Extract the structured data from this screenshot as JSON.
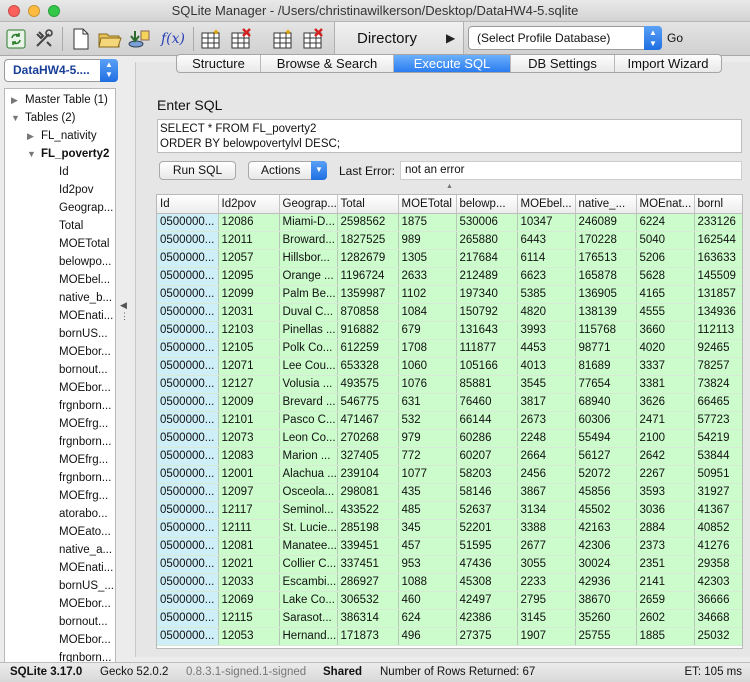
{
  "window": {
    "title": "SQLite Manager - /Users/christinawilkerson/Desktop/DataHW4-5.sqlite"
  },
  "toolbar": {
    "directory_label": "Directory",
    "profile_select": "(Select Profile Database)",
    "go_label": "Go",
    "fx_label": "f(x)"
  },
  "sidebar": {
    "db_select": "DataHW4-5....",
    "tree": [
      {
        "label": "Master Table (1)",
        "indent": 0,
        "tri": "▶",
        "bold": false
      },
      {
        "label": "Tables (2)",
        "indent": 0,
        "tri": "▼",
        "bold": false
      },
      {
        "label": "FL_nativity",
        "indent": 1,
        "tri": "▶",
        "bold": false
      },
      {
        "label": "FL_poverty2",
        "indent": 1,
        "tri": "▼",
        "bold": true
      },
      {
        "label": "Id",
        "indent": 2,
        "tri": "",
        "bold": false
      },
      {
        "label": "Id2pov",
        "indent": 2,
        "tri": "",
        "bold": false
      },
      {
        "label": "Geograp...",
        "indent": 2,
        "tri": "",
        "bold": false
      },
      {
        "label": "Total",
        "indent": 2,
        "tri": "",
        "bold": false
      },
      {
        "label": "MOETotal",
        "indent": 2,
        "tri": "",
        "bold": false
      },
      {
        "label": "belowpo...",
        "indent": 2,
        "tri": "",
        "bold": false
      },
      {
        "label": "MOEbel...",
        "indent": 2,
        "tri": "",
        "bold": false
      },
      {
        "label": "native_b...",
        "indent": 2,
        "tri": "",
        "bold": false
      },
      {
        "label": "MOEnati...",
        "indent": 2,
        "tri": "",
        "bold": false
      },
      {
        "label": "bornUS...",
        "indent": 2,
        "tri": "",
        "bold": false
      },
      {
        "label": "MOEbor...",
        "indent": 2,
        "tri": "",
        "bold": false
      },
      {
        "label": "bornout...",
        "indent": 2,
        "tri": "",
        "bold": false
      },
      {
        "label": "MOEbor...",
        "indent": 2,
        "tri": "",
        "bold": false
      },
      {
        "label": "frgnborn...",
        "indent": 2,
        "tri": "",
        "bold": false
      },
      {
        "label": "MOEfrg...",
        "indent": 2,
        "tri": "",
        "bold": false
      },
      {
        "label": "frgnborn...",
        "indent": 2,
        "tri": "",
        "bold": false
      },
      {
        "label": "MOEfrg...",
        "indent": 2,
        "tri": "",
        "bold": false
      },
      {
        "label": "frgnborn...",
        "indent": 2,
        "tri": "",
        "bold": false
      },
      {
        "label": "MOEfrg...",
        "indent": 2,
        "tri": "",
        "bold": false
      },
      {
        "label": "atorabo...",
        "indent": 2,
        "tri": "",
        "bold": false
      },
      {
        "label": "MOEato...",
        "indent": 2,
        "tri": "",
        "bold": false
      },
      {
        "label": "native_a...",
        "indent": 2,
        "tri": "",
        "bold": false
      },
      {
        "label": "MOEnati...",
        "indent": 2,
        "tri": "",
        "bold": false
      },
      {
        "label": "bornUS_...",
        "indent": 2,
        "tri": "",
        "bold": false
      },
      {
        "label": "MOEbor...",
        "indent": 2,
        "tri": "",
        "bold": false
      },
      {
        "label": "bornout...",
        "indent": 2,
        "tri": "",
        "bold": false
      },
      {
        "label": "MOEbor...",
        "indent": 2,
        "tri": "",
        "bold": false
      },
      {
        "label": "frgnborn...",
        "indent": 2,
        "tri": "",
        "bold": false
      }
    ]
  },
  "tabs": [
    {
      "label": "Structure",
      "active": false
    },
    {
      "label": "Browse & Search",
      "active": false
    },
    {
      "label": "Execute SQL",
      "active": true
    },
    {
      "label": "DB Settings",
      "active": false
    },
    {
      "label": "Import Wizard",
      "active": false
    }
  ],
  "sql": {
    "heading": "Enter SQL",
    "query": "SELECT * FROM FL_poverty2\nORDER BY belowpovertylvl DESC;",
    "run_label": "Run SQL",
    "actions_label": "Actions",
    "last_error_label": "Last Error:",
    "last_error_value": "not an error"
  },
  "grid": {
    "columns": [
      "Id",
      "Id2pov",
      "Geograp...",
      "Total",
      "MOETotal",
      "belowp...",
      "MOEbel...",
      "native_...",
      "MOEnat...",
      "bornl"
    ],
    "rows": [
      [
        "0500000...",
        "12086",
        "Miami-D...",
        "2598562",
        "1875",
        "530006",
        "10347",
        "246089",
        "6224",
        "233126"
      ],
      [
        "0500000...",
        "12011",
        "Broward...",
        "1827525",
        "989",
        "265880",
        "6443",
        "170228",
        "5040",
        "162544"
      ],
      [
        "0500000...",
        "12057",
        "Hillsbor...",
        "1282679",
        "1305",
        "217684",
        "6114",
        "176513",
        "5206",
        "163633"
      ],
      [
        "0500000...",
        "12095",
        "Orange ...",
        "1196724",
        "2633",
        "212489",
        "6623",
        "165878",
        "5628",
        "145509"
      ],
      [
        "0500000...",
        "12099",
        "Palm Be...",
        "1359987",
        "1102",
        "197340",
        "5385",
        "136905",
        "4165",
        "131857"
      ],
      [
        "0500000...",
        "12031",
        "Duval C...",
        "870858",
        "1084",
        "150792",
        "4820",
        "138139",
        "4555",
        "134936"
      ],
      [
        "0500000...",
        "12103",
        "Pinellas ...",
        "916882",
        "679",
        "131643",
        "3993",
        "115768",
        "3660",
        "112113"
      ],
      [
        "0500000...",
        "12105",
        "Polk Co...",
        "612259",
        "1708",
        "111877",
        "4453",
        "98771",
        "4020",
        "92465"
      ],
      [
        "0500000...",
        "12071",
        "Lee Cou...",
        "653328",
        "1060",
        "105166",
        "4013",
        "81689",
        "3337",
        "78257"
      ],
      [
        "0500000...",
        "12127",
        "Volusia ...",
        "493575",
        "1076",
        "85881",
        "3545",
        "77654",
        "3381",
        "73824"
      ],
      [
        "0500000...",
        "12009",
        "Brevard ...",
        "546775",
        "631",
        "76460",
        "3817",
        "68940",
        "3626",
        "66465"
      ],
      [
        "0500000...",
        "12101",
        "Pasco C...",
        "471467",
        "532",
        "66144",
        "2673",
        "60306",
        "2471",
        "57723"
      ],
      [
        "0500000...",
        "12073",
        "Leon Co...",
        "270268",
        "979",
        "60286",
        "2248",
        "55494",
        "2100",
        "54219"
      ],
      [
        "0500000...",
        "12083",
        "Marion ...",
        "327405",
        "772",
        "60207",
        "2664",
        "56127",
        "2642",
        "53844"
      ],
      [
        "0500000...",
        "12001",
        "Alachua ...",
        "239104",
        "1077",
        "58203",
        "2456",
        "52072",
        "2267",
        "50951"
      ],
      [
        "0500000...",
        "12097",
        "Osceola...",
        "298081",
        "435",
        "58146",
        "3867",
        "45856",
        "3593",
        "31927"
      ],
      [
        "0500000...",
        "12117",
        "Seminol...",
        "433522",
        "485",
        "52637",
        "3134",
        "45502",
        "3036",
        "41367"
      ],
      [
        "0500000...",
        "12111",
        "St. Lucie...",
        "285198",
        "345",
        "52201",
        "3388",
        "42163",
        "2884",
        "40852"
      ],
      [
        "0500000...",
        "12081",
        "Manatee...",
        "339451",
        "457",
        "51595",
        "2677",
        "42306",
        "2373",
        "41276"
      ],
      [
        "0500000...",
        "12021",
        "Collier C...",
        "337451",
        "953",
        "47436",
        "3055",
        "30024",
        "2351",
        "29358"
      ],
      [
        "0500000...",
        "12033",
        "Escambi...",
        "286927",
        "1088",
        "45308",
        "2233",
        "42936",
        "2141",
        "42303"
      ],
      [
        "0500000...",
        "12069",
        "Lake Co...",
        "306532",
        "460",
        "42497",
        "2795",
        "38670",
        "2659",
        "36666"
      ],
      [
        "0500000...",
        "12115",
        "Sarasot...",
        "386314",
        "624",
        "42386",
        "3145",
        "35260",
        "2602",
        "34668"
      ],
      [
        "0500000...",
        "12053",
        "Hernand...",
        "171873",
        "496",
        "27375",
        "1907",
        "25755",
        "1885",
        "25032"
      ]
    ]
  },
  "status": {
    "sqlite": "SQLite 3.17.0",
    "gecko": "Gecko 52.0.2",
    "ext": "0.8.3.1-signed.1-signed",
    "shared": "Shared",
    "rows": "Number of Rows Returned: 67",
    "et": "ET: 105 ms"
  },
  "colors": {
    "accent": "#2a7cf0",
    "grid_green": "#ccfccc",
    "grid_blue": "#cfeff8"
  }
}
